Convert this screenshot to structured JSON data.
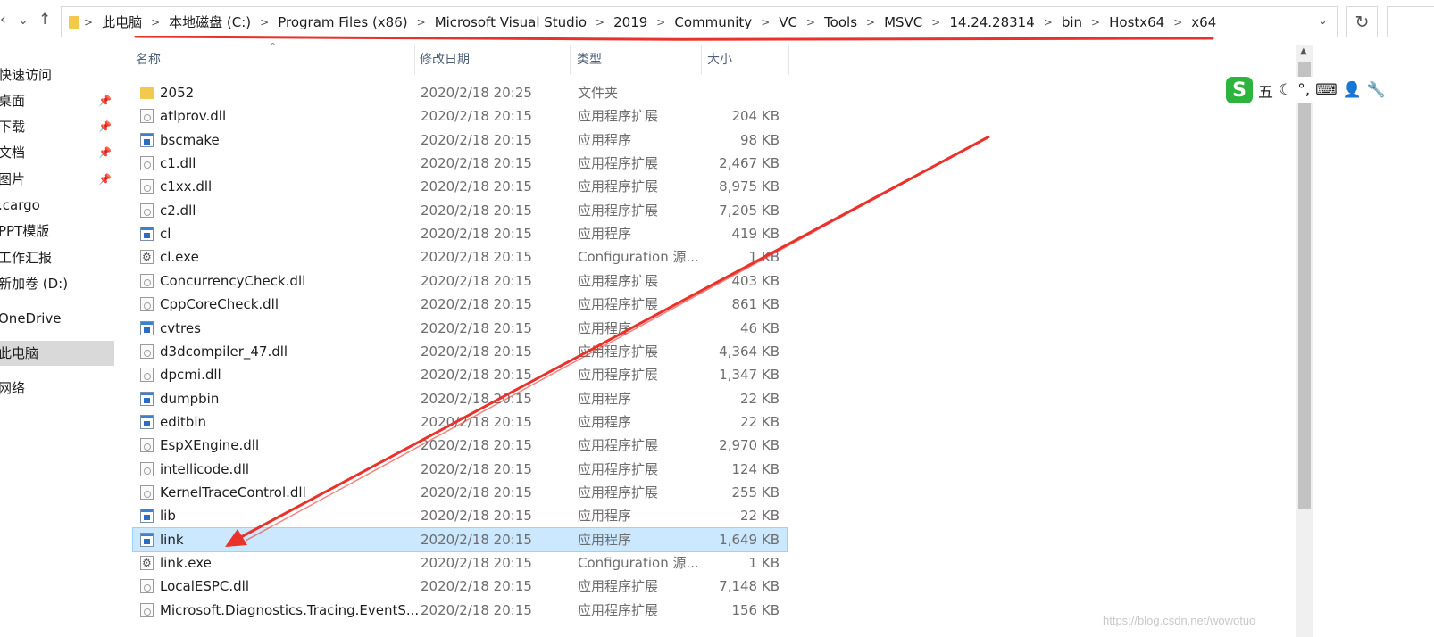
{
  "nav": {
    "back_glyph": "‹",
    "dropdown_glyph": "⌄",
    "up_glyph": "↑"
  },
  "breadcrumb": [
    "此电脑",
    "本地磁盘 (C:)",
    "Program Files (x86)",
    "Microsoft Visual Studio",
    "2019",
    "Community",
    "VC",
    "Tools",
    "MSVC",
    "14.24.28314",
    "bin",
    "Hostx64",
    "x64"
  ],
  "address_dropdown_glyph": "⌄",
  "refresh_glyph": "↻",
  "sidebar": {
    "items": [
      {
        "label": "快速访问",
        "pinned": false,
        "selected": false
      },
      {
        "label": "桌面",
        "pinned": true,
        "selected": false
      },
      {
        "label": "下载",
        "pinned": true,
        "selected": false
      },
      {
        "label": "文档",
        "pinned": true,
        "selected": false
      },
      {
        "label": "图片",
        "pinned": true,
        "selected": false
      },
      {
        "label": ".cargo",
        "pinned": false,
        "selected": false
      },
      {
        "label": "PPT模版",
        "pinned": false,
        "selected": false
      },
      {
        "label": "工作汇报",
        "pinned": false,
        "selected": false
      },
      {
        "label": "新加卷 (D:)",
        "pinned": false,
        "selected": false
      },
      {
        "label": "OneDrive",
        "pinned": false,
        "selected": false
      },
      {
        "label": "此电脑",
        "pinned": false,
        "selected": true
      },
      {
        "label": "网络",
        "pinned": false,
        "selected": false
      }
    ],
    "pin_glyph": "📌"
  },
  "columns": {
    "name": "名称",
    "date": "修改日期",
    "type": "类型",
    "size": "大小"
  },
  "files": [
    {
      "icon": "folder-icon",
      "kind": "folder",
      "name": "2052",
      "date": "2020/2/18 20:25",
      "type": "文件夹",
      "size": ""
    },
    {
      "icon": "dll-file-icon",
      "kind": "dll",
      "name": "atlprov.dll",
      "date": "2020/2/18 20:15",
      "type": "应用程序扩展",
      "size": "204 KB"
    },
    {
      "icon": "exe-app-icon",
      "kind": "exe",
      "name": "bscmake",
      "date": "2020/2/18 20:15",
      "type": "应用程序",
      "size": "98 KB"
    },
    {
      "icon": "dll-file-icon",
      "kind": "dll",
      "name": "c1.dll",
      "date": "2020/2/18 20:15",
      "type": "应用程序扩展",
      "size": "2,467 KB"
    },
    {
      "icon": "dll-file-icon",
      "kind": "dll",
      "name": "c1xx.dll",
      "date": "2020/2/18 20:15",
      "type": "应用程序扩展",
      "size": "8,975 KB"
    },
    {
      "icon": "dll-file-icon",
      "kind": "dll",
      "name": "c2.dll",
      "date": "2020/2/18 20:15",
      "type": "应用程序扩展",
      "size": "7,205 KB"
    },
    {
      "icon": "exe-app-icon",
      "kind": "exe",
      "name": "cl",
      "date": "2020/2/18 20:15",
      "type": "应用程序",
      "size": "419 KB"
    },
    {
      "icon": "config-file-icon",
      "kind": "cfg",
      "name": "cl.exe",
      "date": "2020/2/18 20:15",
      "type": "Configuration 源...",
      "size": "1 KB"
    },
    {
      "icon": "dll-file-icon",
      "kind": "dll",
      "name": "ConcurrencyCheck.dll",
      "date": "2020/2/18 20:15",
      "type": "应用程序扩展",
      "size": "403 KB"
    },
    {
      "icon": "dll-file-icon",
      "kind": "dll",
      "name": "CppCoreCheck.dll",
      "date": "2020/2/18 20:15",
      "type": "应用程序扩展",
      "size": "861 KB"
    },
    {
      "icon": "exe-app-icon",
      "kind": "exe",
      "name": "cvtres",
      "date": "2020/2/18 20:15",
      "type": "应用程序",
      "size": "46 KB"
    },
    {
      "icon": "dll-file-icon",
      "kind": "dll",
      "name": "d3dcompiler_47.dll",
      "date": "2020/2/18 20:15",
      "type": "应用程序扩展",
      "size": "4,364 KB"
    },
    {
      "icon": "dll-file-icon",
      "kind": "dll",
      "name": "dpcmi.dll",
      "date": "2020/2/18 20:15",
      "type": "应用程序扩展",
      "size": "1,347 KB"
    },
    {
      "icon": "exe-app-icon",
      "kind": "exe",
      "name": "dumpbin",
      "date": "2020/2/18 20:15",
      "type": "应用程序",
      "size": "22 KB"
    },
    {
      "icon": "exe-app-icon",
      "kind": "exe",
      "name": "editbin",
      "date": "2020/2/18 20:15",
      "type": "应用程序",
      "size": "22 KB"
    },
    {
      "icon": "dll-file-icon",
      "kind": "dll",
      "name": "EspXEngine.dll",
      "date": "2020/2/18 20:15",
      "type": "应用程序扩展",
      "size": "2,970 KB"
    },
    {
      "icon": "dll-file-icon",
      "kind": "dll",
      "name": "intellicode.dll",
      "date": "2020/2/18 20:15",
      "type": "应用程序扩展",
      "size": "124 KB"
    },
    {
      "icon": "dll-file-icon",
      "kind": "dll",
      "name": "KernelTraceControl.dll",
      "date": "2020/2/18 20:15",
      "type": "应用程序扩展",
      "size": "255 KB"
    },
    {
      "icon": "exe-app-icon",
      "kind": "exe",
      "name": "lib",
      "date": "2020/2/18 20:15",
      "type": "应用程序",
      "size": "22 KB"
    },
    {
      "icon": "exe-app-icon",
      "kind": "exe",
      "name": "link",
      "date": "2020/2/18 20:15",
      "type": "应用程序",
      "size": "1,649 KB",
      "selected": true
    },
    {
      "icon": "config-file-icon",
      "kind": "cfg",
      "name": "link.exe",
      "date": "2020/2/18 20:15",
      "type": "Configuration 源...",
      "size": "1 KB"
    },
    {
      "icon": "dll-file-icon",
      "kind": "dll",
      "name": "LocalESPC.dll",
      "date": "2020/2/18 20:15",
      "type": "应用程序扩展",
      "size": "7,148 KB"
    },
    {
      "icon": "dll-file-icon",
      "kind": "dll",
      "name": "Microsoft.Diagnostics.Tracing.EventS...",
      "date": "2020/2/18 20:15",
      "type": "应用程序扩展",
      "size": "156 KB"
    }
  ],
  "ime_toolbar": {
    "logo": "S",
    "items": [
      "五",
      "☾",
      "°,",
      "⌨",
      "👤",
      "🔧"
    ]
  },
  "watermark": "https://blog.csdn.net/wowotuo",
  "colors": {
    "annotation_red": "#e8322b",
    "selection_bg": "#cce8ff",
    "ime_green": "#2db43f"
  }
}
